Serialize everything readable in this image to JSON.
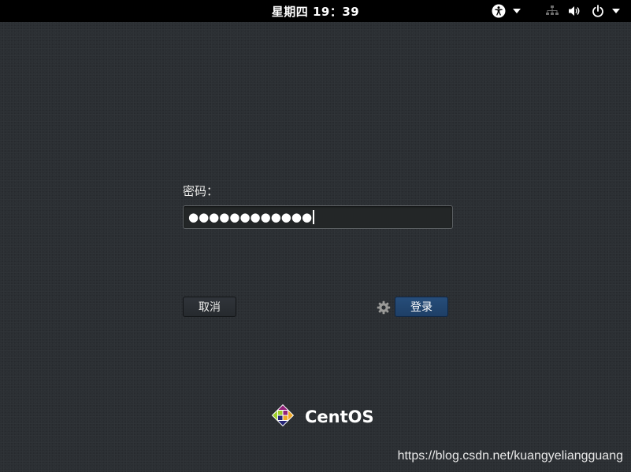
{
  "top_bar": {
    "clock": "星期四 19：39",
    "indicators": {
      "accessibility": "accessibility-icon",
      "network": "network-wired-icon",
      "volume": "speaker-icon",
      "power": "power-icon",
      "menu_arrow": "chevron-down-icon"
    }
  },
  "login": {
    "password_label": "密码：",
    "password_masked": "●●●●●●●●●●●●",
    "cancel_label": "取消",
    "login_label": "登录",
    "settings_icon": "gear-icon"
  },
  "branding": {
    "logo_text": "CentOS",
    "logo_icon": "centos-logo-icon"
  },
  "watermark": "https://blog.csdn.net/kuangyeliangguang",
  "colors": {
    "background": "#2b2f33",
    "top_bar": "#000000",
    "login_button": "#244a76",
    "field_border": "#5c6063"
  }
}
